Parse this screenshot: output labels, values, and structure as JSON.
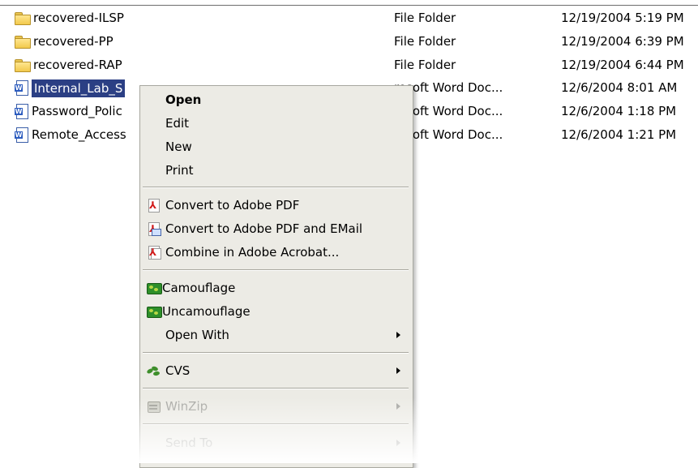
{
  "files": [
    {
      "icon": "folder-icon",
      "name": "recovered-ILSP",
      "type": "File Folder",
      "date": "12/19/2004 5:19 PM",
      "selected": false
    },
    {
      "icon": "folder-icon",
      "name": "recovered-PP",
      "type": "File Folder",
      "date": "12/19/2004 6:39 PM",
      "selected": false
    },
    {
      "icon": "folder-icon",
      "name": "recovered-RAP",
      "type": "File Folder",
      "date": "12/19/2004 6:44 PM",
      "selected": false
    },
    {
      "icon": "word-document-icon",
      "name": "Internal_Lab_S",
      "type": "rosoft Word Doc...",
      "date": "12/6/2004 8:01 AM",
      "selected": true
    },
    {
      "icon": "word-document-icon",
      "name": "Password_Polic",
      "type": "rosoft Word Doc...",
      "date": "12/6/2004 1:18 PM",
      "selected": false
    },
    {
      "icon": "word-document-icon",
      "name": "Remote_Access",
      "type": "rosoft Word Doc...",
      "date": "12/6/2004 1:21 PM",
      "selected": false
    }
  ],
  "context_menu": {
    "items": [
      {
        "label": "Open",
        "bold": true
      },
      {
        "label": "Edit"
      },
      {
        "label": "New"
      },
      {
        "label": "Print"
      },
      {
        "label": "Convert to Adobe PDF",
        "icon": "pdf-icon"
      },
      {
        "label": "Convert to Adobe PDF and EMail",
        "icon": "pdf-email-icon"
      },
      {
        "label": "Combine in Adobe Acrobat...",
        "icon": "acrobat-combine-icon"
      },
      {
        "label": "Camouflage",
        "icon": "camouflage-icon"
      },
      {
        "label": "Uncamouflage",
        "icon": "uncamouflage-icon"
      },
      {
        "label": "Open With",
        "submenu": true
      },
      {
        "label": "CVS",
        "icon": "cvs-turtle-icon",
        "submenu": true
      },
      {
        "label": "WinZip",
        "icon": "winzip-icon",
        "submenu": true,
        "disabled": true
      },
      {
        "label": "Send To",
        "submenu": true,
        "disabled": true
      }
    ]
  },
  "colors": {
    "selection": "#2b3f84",
    "menu_background": "#ecebe5",
    "disabled_text": "#a7a7a3"
  }
}
